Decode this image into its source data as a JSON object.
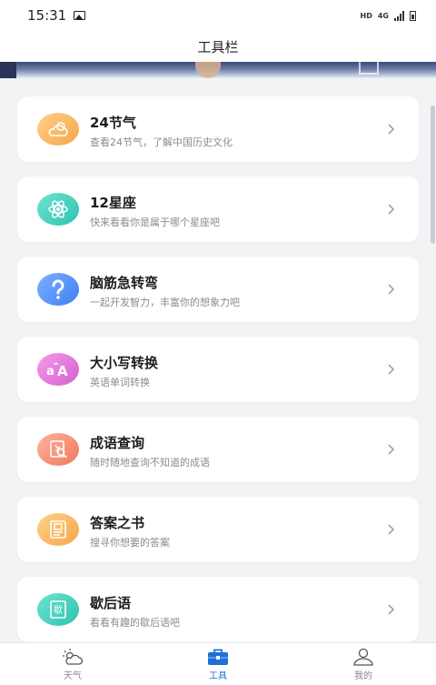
{
  "status_bar": {
    "time": "15:31",
    "network_hd": "HD",
    "network_type": "4G"
  },
  "header": {
    "title": "工具栏"
  },
  "tools": [
    {
      "title": "24节气",
      "subtitle": "查看24节气，了解中国历史文化",
      "icon": "cloud-sun-icon",
      "color_from": "#ffd08a",
      "color_to": "#f5a64a"
    },
    {
      "title": "12星座",
      "subtitle": "快来看看你是属于哪个星座吧",
      "icon": "atom-icon",
      "color_from": "#6fe3d0",
      "color_to": "#2cc3b0"
    },
    {
      "title": "脑筋急转弯",
      "subtitle": "一起开发智力，丰富你的想象力吧",
      "icon": "question-icon",
      "color_from": "#7fb0ff",
      "color_to": "#3d7ef2"
    },
    {
      "title": "大小写转换",
      "subtitle": "英语单词转换",
      "icon": "case-convert-icon",
      "color_from": "#f59be8",
      "color_to": "#d65fd2"
    },
    {
      "title": "成语查询",
      "subtitle": "随时随地查询不知道的成语",
      "icon": "book-search-icon",
      "color_from": "#ffb39a",
      "color_to": "#f07860"
    },
    {
      "title": "答案之书",
      "subtitle": "搜寻你想要的答案",
      "icon": "answer-book-icon",
      "color_from": "#ffd08a",
      "color_to": "#f5a64a"
    },
    {
      "title": "歇后语",
      "subtitle": "看看有趣的歇后语吧",
      "icon": "xiehouyu-book-icon",
      "color_from": "#6fe3d0",
      "color_to": "#2cc3b0",
      "icon_text": "歇"
    }
  ],
  "tabbar": {
    "items": [
      {
        "label": "天气",
        "icon": "weather-icon",
        "active": false
      },
      {
        "label": "工具",
        "icon": "toolbox-icon",
        "active": true
      },
      {
        "label": "我的",
        "icon": "user-icon",
        "active": false
      }
    ]
  },
  "colors": {
    "accent": "#1f6fd6",
    "background": "#f2f3f5"
  }
}
